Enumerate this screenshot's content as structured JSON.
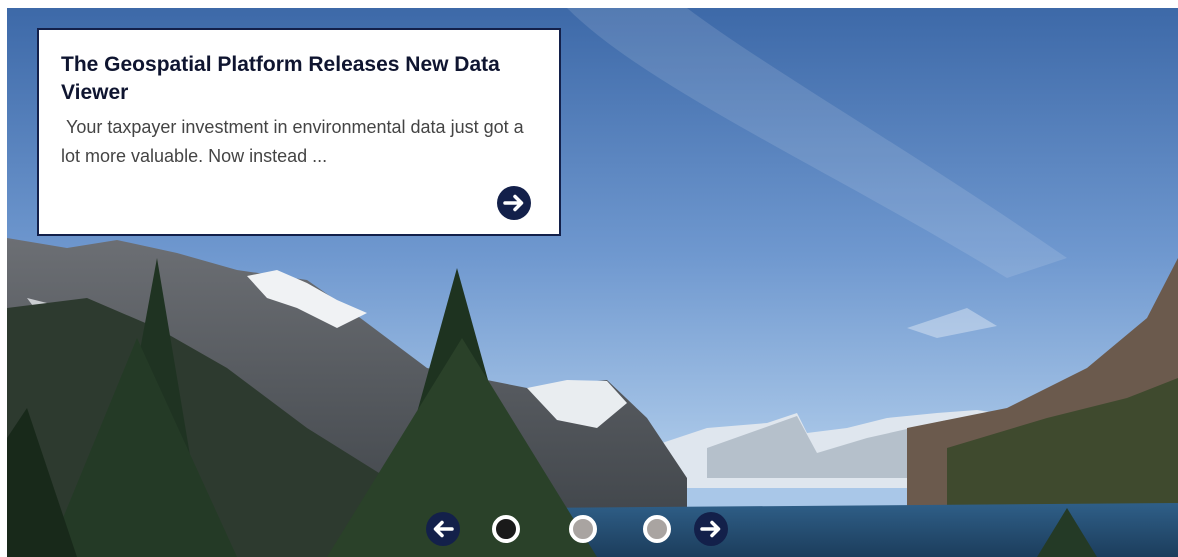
{
  "slide": {
    "image": "mountain-lake-landscape",
    "title": "The Geospatial Platform Releases New Data Viewer",
    "excerpt": " Your taxpayer investment in environmental data just got a lot more valuable. Now instead ...",
    "read_more_icon": "arrow-right-circle-icon"
  },
  "carousel": {
    "prev_icon": "arrow-left-icon",
    "next_icon": "arrow-right-icon",
    "slide_count": 3,
    "active_index": 1
  },
  "colors": {
    "accent": "#13204a",
    "dot_active": "#1a1a1a",
    "dot_inactive": "#a9a4a1"
  }
}
